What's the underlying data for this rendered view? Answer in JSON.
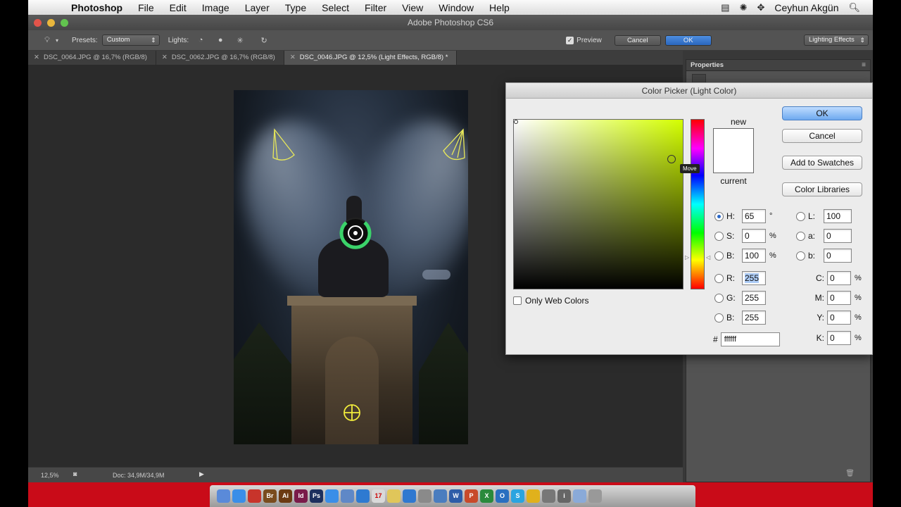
{
  "menubar": {
    "app_name": "Photoshop",
    "items": [
      "File",
      "Edit",
      "Image",
      "Layer",
      "Type",
      "Select",
      "Filter",
      "View",
      "Window",
      "Help"
    ],
    "user": "Ceyhun Akgün"
  },
  "window": {
    "title": "Adobe Photoshop CS6"
  },
  "options": {
    "presets_label": "Presets:",
    "presets_value": "Custom",
    "lights_label": "Lights:",
    "preview_label": "Preview",
    "preview_checked": true,
    "cancel_label": "Cancel",
    "ok_label": "OK",
    "workspace_value": "Lighting Effects"
  },
  "tabs": [
    {
      "label": "DSC_0064.JPG @ 16,7% (RGB/8)",
      "active": false
    },
    {
      "label": "DSC_0062.JPG @ 16,7% (RGB/8)",
      "active": false
    },
    {
      "label": "DSC_0046.JPG @ 12,5% (Light Effects, RGB/8) *",
      "active": true
    }
  ],
  "status": {
    "zoom": "12,5%",
    "doc": "Doc: 34,9M/34,9M"
  },
  "panel": {
    "title": "Properties"
  },
  "picker": {
    "title": "Color Picker (Light Color)",
    "new_label": "new",
    "current_label": "current",
    "tooltip": "Move",
    "buttons": {
      "ok": "OK",
      "cancel": "Cancel",
      "add_swatches": "Add to Swatches",
      "color_libraries": "Color Libraries"
    },
    "only_web_colors": "Only Web Colors",
    "hsb": {
      "h_label": "H:",
      "h": "65",
      "h_unit": "°",
      "s_label": "S:",
      "s": "0",
      "s_unit": "%",
      "b_label": "B:",
      "b": "100",
      "b_unit": "%"
    },
    "rgb": {
      "r_label": "R:",
      "r": "255",
      "g_label": "G:",
      "g": "255",
      "b_label": "B:",
      "b": "255"
    },
    "lab": {
      "l_label": "L:",
      "l": "100",
      "a_label": "a:",
      "a": "0",
      "b_label": "b:",
      "b": "0"
    },
    "cmyk": {
      "c_label": "C:",
      "c": "0",
      "m_label": "M:",
      "m": "0",
      "y_label": "Y:",
      "y": "0",
      "k_label": "K:",
      "k": "0",
      "unit": "%"
    },
    "hex_label": "#",
    "hex": "ffffff",
    "hue_color": "#d4ff00"
  },
  "dock": {
    "icons": [
      "finder-icon",
      "safari-icon",
      "acrobat-icon",
      "bridge-icon",
      "illustrator-icon",
      "indesign-icon",
      "photoshop-icon",
      "globe-icon",
      "mail-icon",
      "itunes-icon",
      "calendar-icon",
      "notes-icon",
      "appstore-icon",
      "system-prefs-icon",
      "preview-icon",
      "word-icon",
      "powerpoint-icon",
      "excel-icon",
      "outlook-icon",
      "skype-icon",
      "chrome-icon",
      "magnifier-icon",
      "info-icon",
      "folder-icon",
      "trash-icon"
    ],
    "labels": [
      "",
      "",
      "",
      "Br",
      "Ai",
      "Id",
      "Ps",
      "",
      "",
      "",
      "17",
      "",
      "",
      "",
      "",
      "W",
      "P",
      "X",
      "O",
      "S",
      "",
      "",
      "i",
      "",
      ""
    ]
  }
}
